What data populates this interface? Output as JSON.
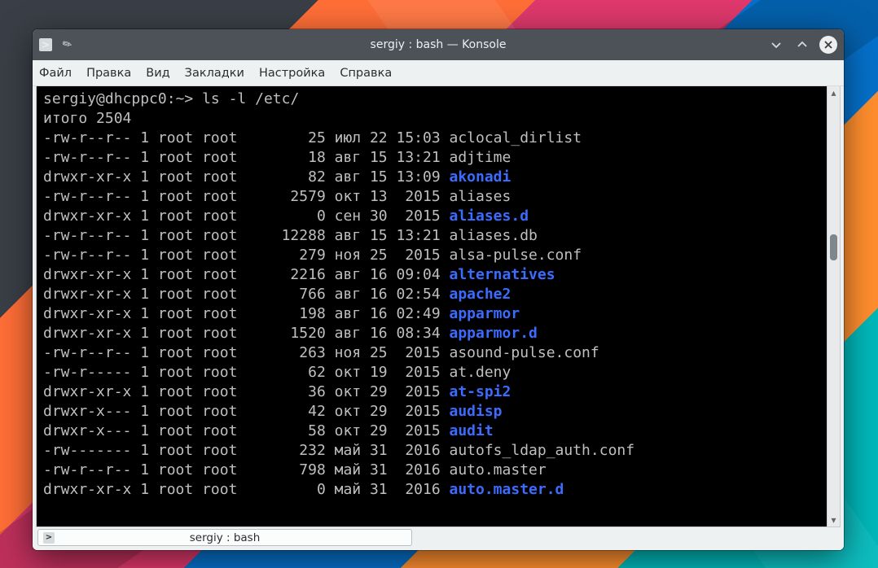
{
  "window": {
    "title": "sergiy : bash — Konsole"
  },
  "menubar": {
    "items": [
      "Файл",
      "Правка",
      "Вид",
      "Закладки",
      "Настройка",
      "Справка"
    ]
  },
  "prompt": {
    "user_host": "sergiy@dhcppc0",
    "cwd": "~",
    "symbol": ">",
    "command": "ls -l /etc/"
  },
  "output": {
    "total_line": "итого 2504",
    "rows": [
      {
        "perm": "-rw-r--r--",
        "n": "1",
        "o": "root",
        "g": "root",
        "size": "25",
        "mon": "июл",
        "day": "22",
        "time": "15:03",
        "name": "aclocal_dirlist",
        "type": "file"
      },
      {
        "perm": "-rw-r--r--",
        "n": "1",
        "o": "root",
        "g": "root",
        "size": "18",
        "mon": "авг",
        "day": "15",
        "time": "13:21",
        "name": "adjtime",
        "type": "file"
      },
      {
        "perm": "drwxr-xr-x",
        "n": "1",
        "o": "root",
        "g": "root",
        "size": "82",
        "mon": "авг",
        "day": "15",
        "time": "13:09",
        "name": "akonadi",
        "type": "dir"
      },
      {
        "perm": "-rw-r--r--",
        "n": "1",
        "o": "root",
        "g": "root",
        "size": "2579",
        "mon": "окт",
        "day": "13",
        "time": " 2015",
        "name": "aliases",
        "type": "file"
      },
      {
        "perm": "drwxr-xr-x",
        "n": "1",
        "o": "root",
        "g": "root",
        "size": "0",
        "mon": "сен",
        "day": "30",
        "time": " 2015",
        "name": "aliases.d",
        "type": "dir"
      },
      {
        "perm": "-rw-r--r--",
        "n": "1",
        "o": "root",
        "g": "root",
        "size": "12288",
        "mon": "авг",
        "day": "15",
        "time": "13:21",
        "name": "aliases.db",
        "type": "file"
      },
      {
        "perm": "-rw-r--r--",
        "n": "1",
        "o": "root",
        "g": "root",
        "size": "279",
        "mon": "ноя",
        "day": "25",
        "time": " 2015",
        "name": "alsa-pulse.conf",
        "type": "file"
      },
      {
        "perm": "drwxr-xr-x",
        "n": "1",
        "o": "root",
        "g": "root",
        "size": "2216",
        "mon": "авг",
        "day": "16",
        "time": "09:04",
        "name": "alternatives",
        "type": "dir"
      },
      {
        "perm": "drwxr-xr-x",
        "n": "1",
        "o": "root",
        "g": "root",
        "size": "766",
        "mon": "авг",
        "day": "16",
        "time": "02:54",
        "name": "apache2",
        "type": "dir"
      },
      {
        "perm": "drwxr-xr-x",
        "n": "1",
        "o": "root",
        "g": "root",
        "size": "198",
        "mon": "авг",
        "day": "16",
        "time": "02:49",
        "name": "apparmor",
        "type": "dir"
      },
      {
        "perm": "drwxr-xr-x",
        "n": "1",
        "o": "root",
        "g": "root",
        "size": "1520",
        "mon": "авг",
        "day": "16",
        "time": "08:34",
        "name": "apparmor.d",
        "type": "dir"
      },
      {
        "perm": "-rw-r--r--",
        "n": "1",
        "o": "root",
        "g": "root",
        "size": "263",
        "mon": "ноя",
        "day": "25",
        "time": " 2015",
        "name": "asound-pulse.conf",
        "type": "file"
      },
      {
        "perm": "-rw-r-----",
        "n": "1",
        "o": "root",
        "g": "root",
        "size": "62",
        "mon": "окт",
        "day": "19",
        "time": " 2015",
        "name": "at.deny",
        "type": "file"
      },
      {
        "perm": "drwxr-xr-x",
        "n": "1",
        "o": "root",
        "g": "root",
        "size": "36",
        "mon": "окт",
        "day": "29",
        "time": " 2015",
        "name": "at-spi2",
        "type": "dir"
      },
      {
        "perm": "drwxr-x---",
        "n": "1",
        "o": "root",
        "g": "root",
        "size": "42",
        "mon": "окт",
        "day": "29",
        "time": " 2015",
        "name": "audisp",
        "type": "dir"
      },
      {
        "perm": "drwxr-x---",
        "n": "1",
        "o": "root",
        "g": "root",
        "size": "58",
        "mon": "окт",
        "day": "29",
        "time": " 2015",
        "name": "audit",
        "type": "dir"
      },
      {
        "perm": "-rw-------",
        "n": "1",
        "o": "root",
        "g": "root",
        "size": "232",
        "mon": "май",
        "day": "31",
        "time": " 2016",
        "name": "autofs_ldap_auth.conf",
        "type": "file"
      },
      {
        "perm": "-rw-r--r--",
        "n": "1",
        "o": "root",
        "g": "root",
        "size": "798",
        "mon": "май",
        "day": "31",
        "time": " 2016",
        "name": "auto.master",
        "type": "file"
      },
      {
        "perm": "drwxr-xr-x",
        "n": "1",
        "o": "root",
        "g": "root",
        "size": "0",
        "mon": "май",
        "day": "31",
        "time": " 2016",
        "name": "auto.master.d",
        "type": "dir"
      }
    ]
  },
  "tab": {
    "label": "sergiy : bash"
  }
}
